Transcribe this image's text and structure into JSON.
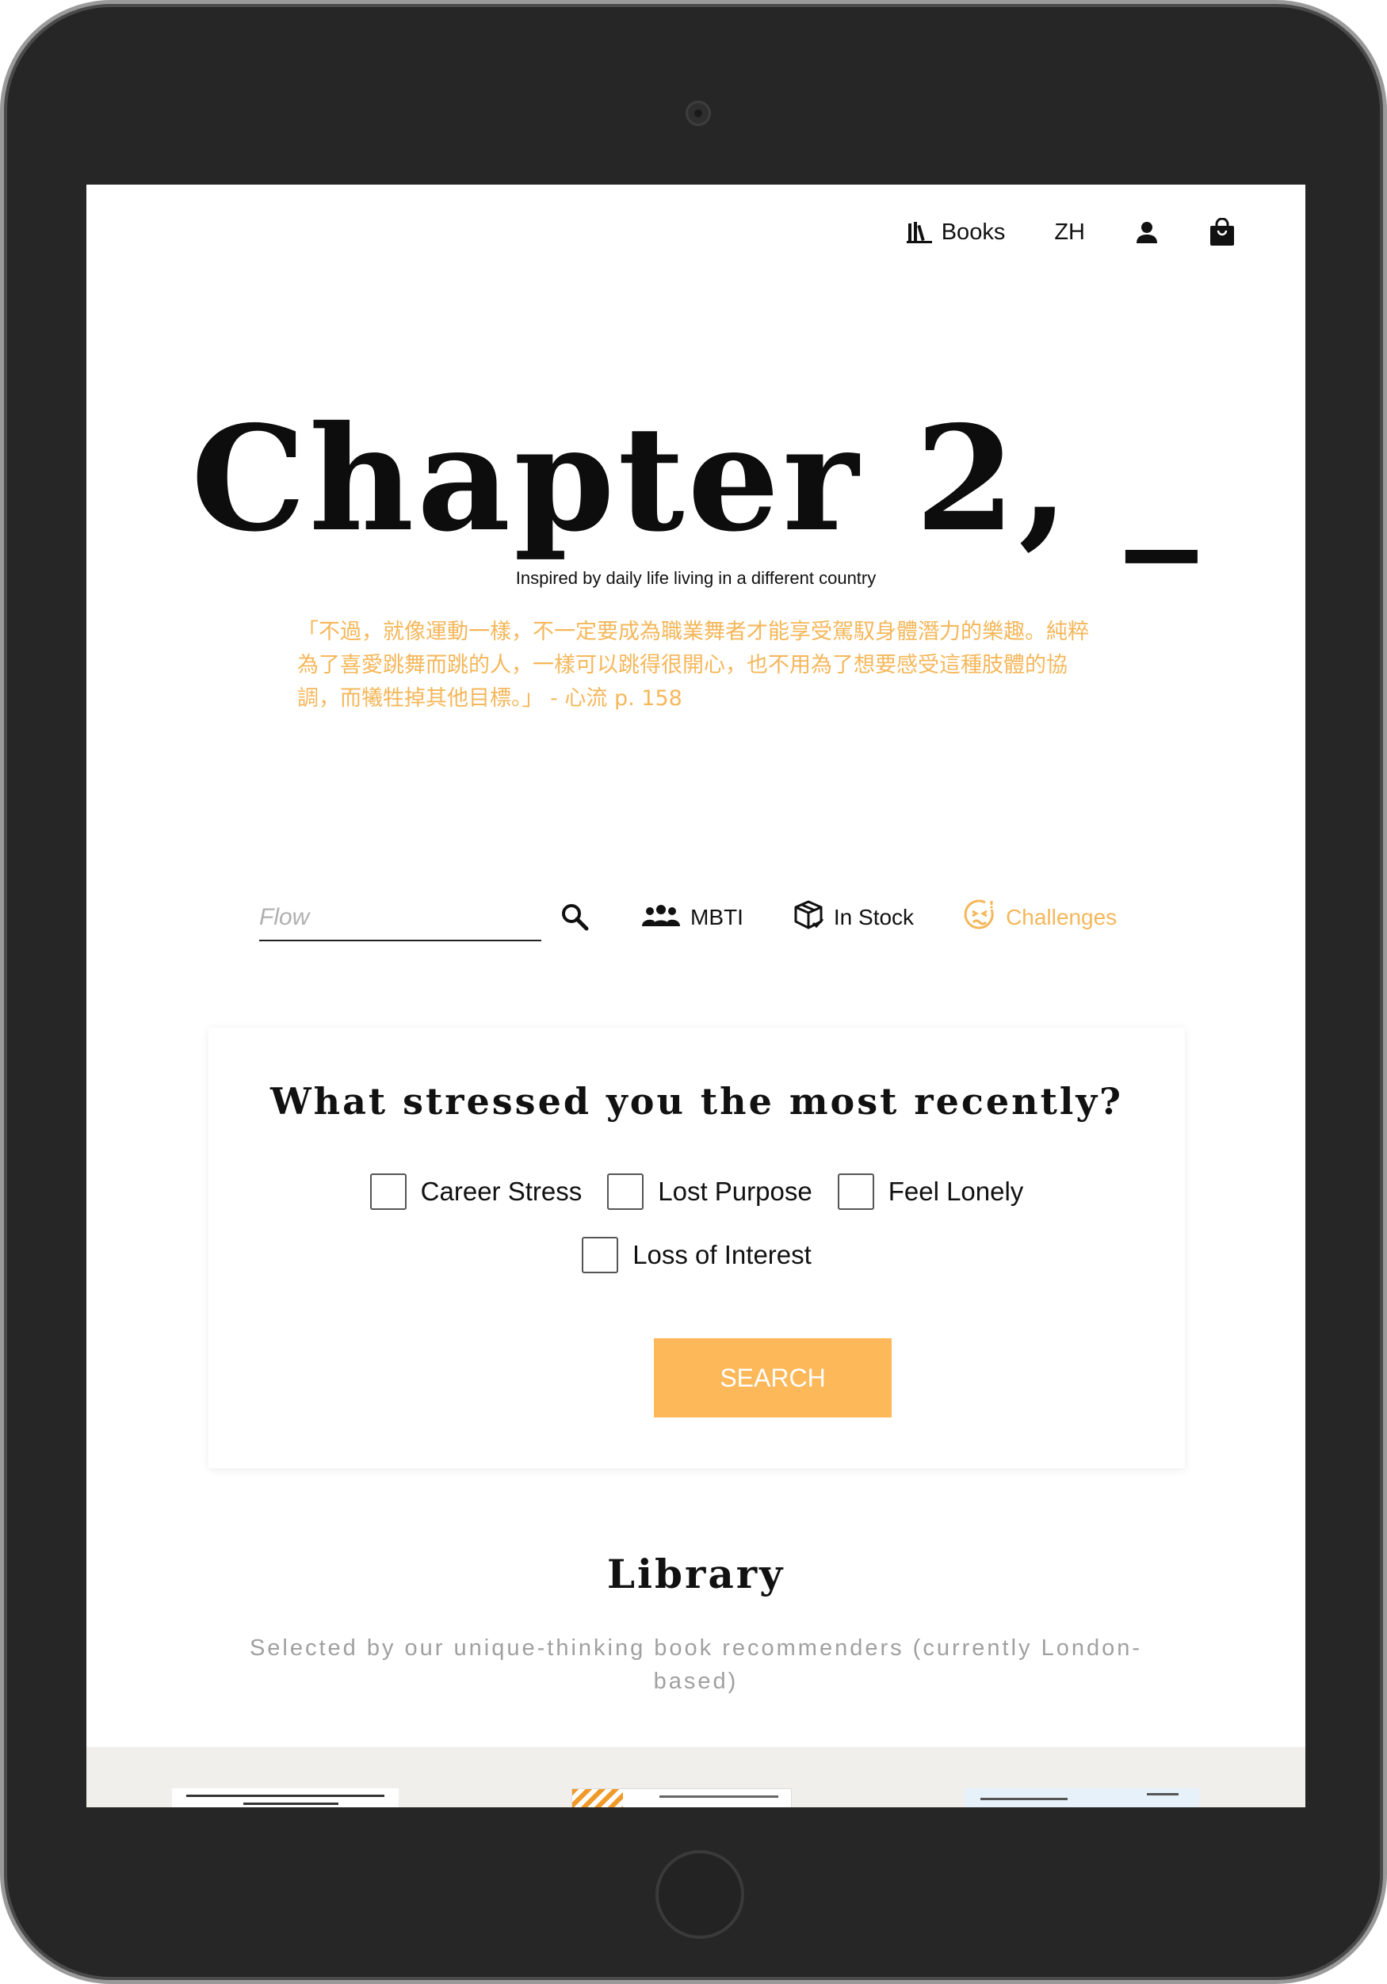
{
  "nav": {
    "books_label": "Books",
    "lang_label": "ZH",
    "icons": {
      "books": "bookshelf-icon",
      "account": "person-icon",
      "cart": "shopping-bag-icon"
    }
  },
  "hero": {
    "title": "Chapter 2, _",
    "subtitle": "Inspired by daily life living in a different country",
    "quote": "「不過，就像運動一樣，不一定要成為職業舞者才能享受駕馭身體潛力的樂趣。純粹為了喜愛跳舞而跳的人，一樣可以跳得很開心，也不用為了想要感受這種肢體的協調，而犧牲掉其他目標。」 - 心流 p. 158"
  },
  "filters": {
    "search_placeholder": "Flow",
    "search_value": "",
    "mbti_label": "MBTI",
    "in_stock_label": "In Stock",
    "challenges_label": "Challenges",
    "active_filter": "Challenges"
  },
  "card": {
    "title": "What stressed you the most recently?",
    "options": [
      {
        "label": "Career Stress",
        "checked": false
      },
      {
        "label": "Lost Purpose",
        "checked": false
      },
      {
        "label": "Feel Lonely",
        "checked": false
      },
      {
        "label": "Loss of Interest",
        "checked": false
      }
    ],
    "submit_label": "SEARCH"
  },
  "library": {
    "title": "Library",
    "subtitle": "Selected by our unique-thinking book recommenders (currently London-based)"
  },
  "colors": {
    "accent": "#f5b75a",
    "button": "#fdb85a",
    "shelf_bg": "#f1efec",
    "device_bezel": "#262626"
  }
}
